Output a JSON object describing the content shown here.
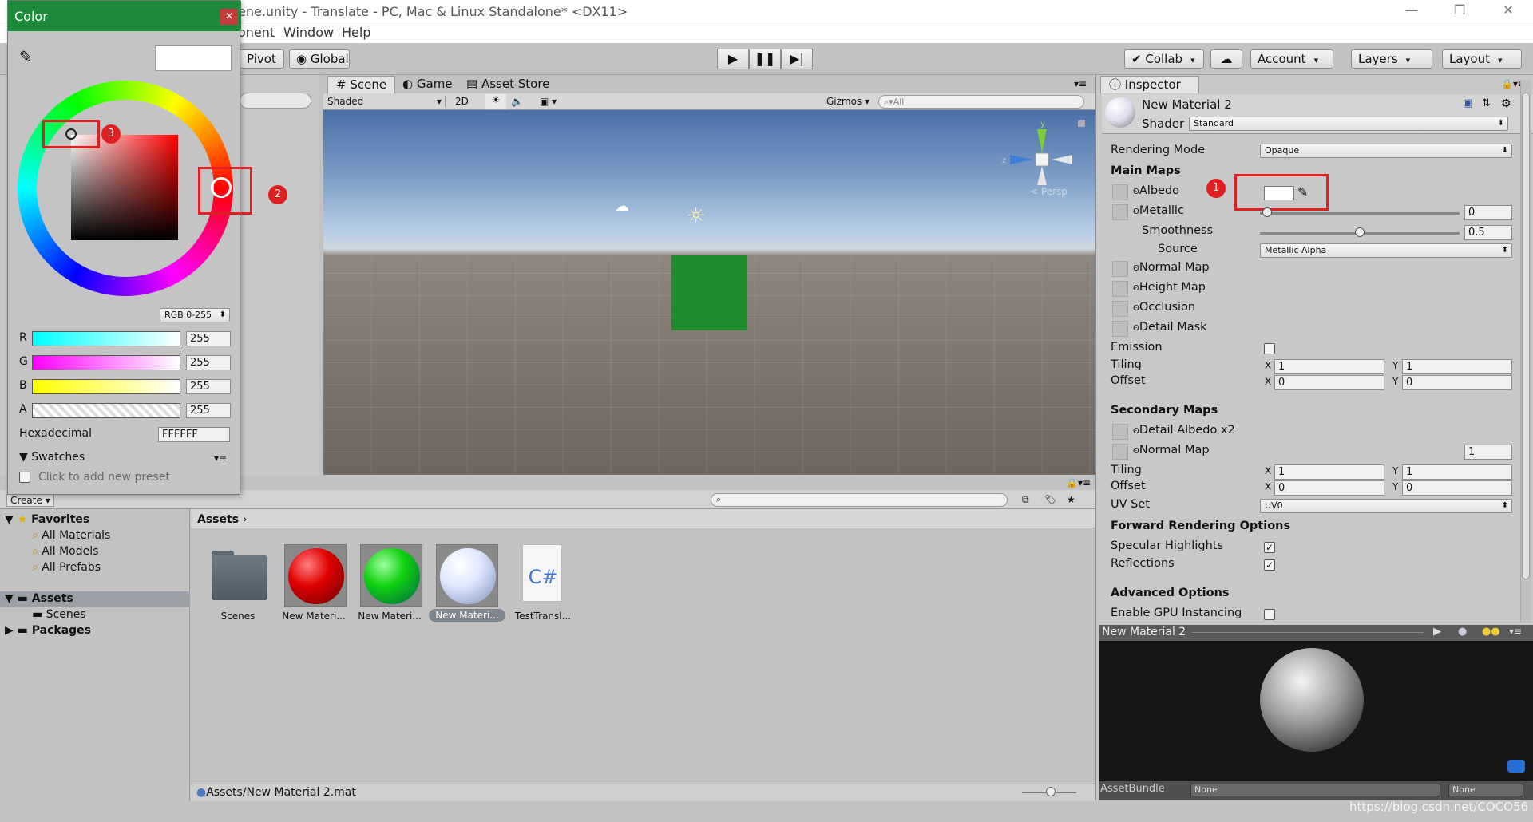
{
  "window": {
    "title": "ene.unity - Translate - PC, Mac & Linux Standalone* <DX11>"
  },
  "menu": [
    "onent",
    "Window",
    "Help"
  ],
  "toolbar": {
    "pivot": "Pivot",
    "global": "Global",
    "collab": "Collab",
    "account": "Account",
    "layers": "Layers",
    "layout": "Layout"
  },
  "scene_tabs": [
    "Scene",
    "Game",
    "Asset Store"
  ],
  "scene_toolbar": {
    "shading": "Shaded",
    "mode2d": "2D",
    "gizmos": "Gizmos",
    "search_placeholder": "All"
  },
  "gizmo": {
    "y": "y",
    "z": "z",
    "persp": "Persp"
  },
  "inspector": {
    "tab": "Inspector",
    "material_name": "New Material 2",
    "shader_label": "Shader",
    "shader_value": "Standard",
    "rendering_mode_label": "Rendering Mode",
    "rendering_mode_value": "Opaque",
    "main_maps": "Main Maps",
    "albedo": "Albedo",
    "metallic": "Metallic",
    "metallic_value": "0",
    "smoothness": "Smoothness",
    "smoothness_value": "0.5",
    "source": "Source",
    "source_value": "Metallic Alpha",
    "normal_map": "Normal Map",
    "height_map": "Height Map",
    "occlusion": "Occlusion",
    "detail_mask": "Detail Mask",
    "emission": "Emission",
    "tiling": "Tiling",
    "offset": "Offset",
    "x": "X",
    "y": "Y",
    "tiling_x": "1",
    "tiling_y": "1",
    "offset_x": "0",
    "offset_y": "0",
    "secondary_maps": "Secondary Maps",
    "detail_albedo": "Detail Albedo x2",
    "normal_map2": "Normal Map",
    "normal_map2_value": "1",
    "tiling2_x": "1",
    "tiling2_y": "1",
    "offset2_x": "0",
    "offset2_y": "0",
    "uv_set": "UV Set",
    "uv_set_value": "UV0",
    "forward_options": "Forward Rendering Options",
    "specular_highlights": "Specular Highlights",
    "reflections": "Reflections",
    "advanced_options": "Advanced Options",
    "gpu_instancing": "Enable GPU Instancing",
    "preview_title": "New Material 2",
    "asset_bundle": "AssetBundle",
    "bundle_value": "None",
    "bundle_variant": "None"
  },
  "project": {
    "create": "Create",
    "favorites": "Favorites",
    "fav_items": [
      "All Materials",
      "All Models",
      "All Prefabs"
    ],
    "assets": "Assets",
    "scenes": "Scenes",
    "packages": "Packages",
    "breadcrumb": "Assets",
    "items": [
      {
        "label": "Scenes"
      },
      {
        "label": "New Materi..."
      },
      {
        "label": "New Materi..."
      },
      {
        "label": "New Materi..."
      },
      {
        "label": "TestTransl..."
      }
    ],
    "csharp": "C#",
    "status_path": "Assets/New Material 2.mat"
  },
  "color_picker": {
    "title": "Color",
    "mode": "RGB 0-255",
    "r_label": "R",
    "g_label": "G",
    "b_label": "B",
    "a_label": "A",
    "r": "255",
    "g": "255",
    "b": "255",
    "a": "255",
    "hex_label": "Hexadecimal",
    "hex": "FFFFFF",
    "swatches": "Swatches",
    "add_preset": "Click to add new preset"
  },
  "annotations": [
    "1",
    "2",
    "3"
  ],
  "watermark": "https://blog.csdn.net/COCO56",
  "colors": {
    "accent_red": "#e02020",
    "title_green": "#1c8a3a",
    "cube_green": "#1e8c2d"
  }
}
